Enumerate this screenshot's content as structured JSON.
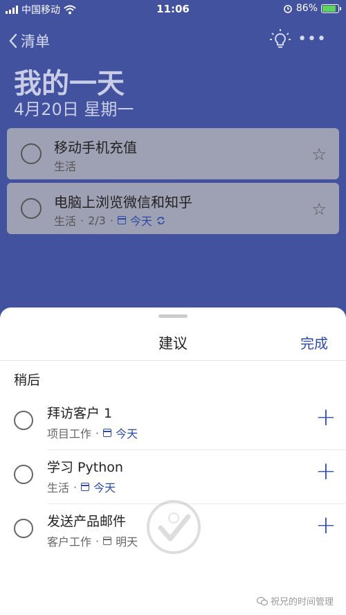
{
  "status_bar": {
    "carrier": "中国移动",
    "time": "11:06",
    "battery": "86%",
    "battery_level": 0.86
  },
  "nav": {
    "back_label": "清单",
    "more_label": "•••"
  },
  "header": {
    "title": "我的一天",
    "date": "4月20日 星期一"
  },
  "tasks": [
    {
      "title": "移动手机充值",
      "list": "生活"
    },
    {
      "title": "电脑上浏览微信和知乎",
      "list": "生活",
      "steps": "2/3",
      "due": "今天"
    }
  ],
  "sheet": {
    "title": "建议",
    "done_label": "完成",
    "section_label": "稍后",
    "suggestions": [
      {
        "title": "拜访客户 1",
        "list": "项目工作",
        "due": "今天",
        "due_highlight": true
      },
      {
        "title": "学习 Python",
        "list": "生活",
        "due": "今天",
        "due_highlight": true
      },
      {
        "title": "发送产品邮件",
        "list": "客户工作",
        "due": "明天",
        "due_highlight": false
      }
    ]
  },
  "watermark": {
    "credit": "祝兄的时间管理"
  },
  "colors": {
    "accent": "#2b4aa8",
    "background": "#42529f",
    "task_card": "#9ea0b4"
  }
}
